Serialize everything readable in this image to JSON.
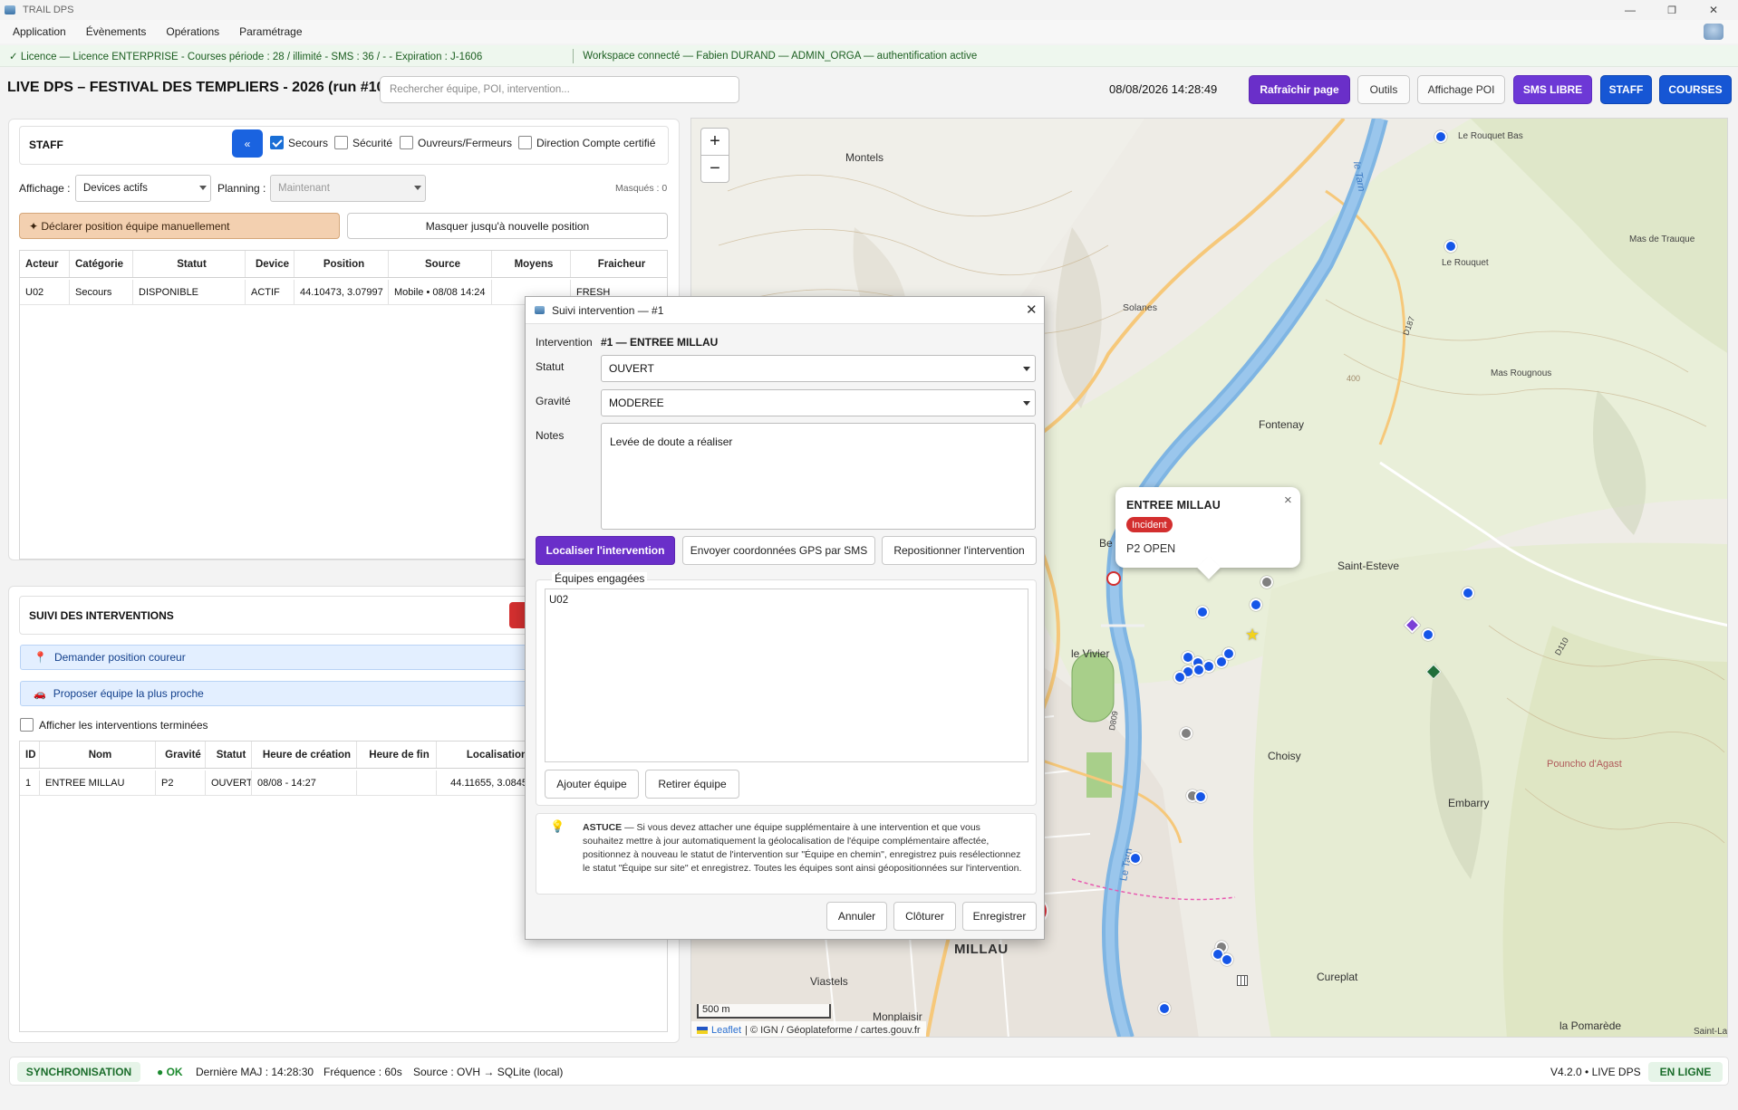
{
  "window": {
    "title": "TRAIL DPS",
    "minimize": "—",
    "maximize": "❐",
    "close": "✕"
  },
  "menu": [
    "Application",
    "Évènements",
    "Opérations",
    "Paramétrage"
  ],
  "license": {
    "left": "✓ Licence — Licence ENTERPRISE - Courses période : 28 / illimité - SMS : 36 / - - Expiration : J-1606",
    "right": "Workspace connecté — Fabien DURAND — ADMIN_ORGA — authentification active"
  },
  "header": {
    "title": "LIVE DPS – FESTIVAL DES TEMPLIERS - 2026 (run #10)",
    "search_placeholder": "Rechercher équipe, POI, intervention...",
    "datetime": "08/08/2026  14:28:49",
    "buttons": [
      "Rafraîchir page",
      "Outils",
      "Affichage POI",
      "SMS LIBRE",
      "STAFF",
      "COURSES"
    ]
  },
  "staff": {
    "title": "STAFF",
    "collapse_label": "«",
    "filters": [
      {
        "label": "Secours",
        "checked": true
      },
      {
        "label": "Sécurité",
        "checked": false
      },
      {
        "label": "Ouvreurs/Fermeurs",
        "checked": false
      },
      {
        "label": "Direction Compte certifié",
        "checked": false
      }
    ],
    "affichage_label": "Affichage :",
    "affichage_value": "Devices actifs",
    "planning_label": "Planning :",
    "planning_value": "Maintenant",
    "masques": "Masqués : 0",
    "declare_button": "✦  Déclarer position équipe manuellement",
    "hide_button": "Masquer jusqu'à nouvelle position",
    "columns": [
      "Acteur",
      "Catégorie",
      "Statut",
      "Device",
      "Position",
      "Source",
      "Moyens",
      "Fraicheur"
    ],
    "rows": [
      [
        "U02",
        "Secours",
        "DISPONIBLE",
        "ACTIF",
        "44.10473, 3.07997",
        "Mobile • 08/08 14:24",
        "",
        "FRESH"
      ]
    ]
  },
  "interventions": {
    "title": "SUIVI DES INTERVENTIONS",
    "request_runner": "Demander position coureur",
    "propose_team": "Proposer équipe la plus proche",
    "show_finished": "Afficher les interventions terminées",
    "columns": [
      "ID",
      "Nom",
      "Gravité",
      "Statut",
      "Heure de création",
      "Heure de fin",
      "Localisation"
    ],
    "rows": [
      [
        "1",
        "ENTREE MILLAU",
        "P2",
        "OUVERT",
        "08/08 - 14:27",
        "",
        "44.11655, 3.0845"
      ]
    ]
  },
  "map": {
    "zoom_in": "+",
    "zoom_out": "−",
    "scale": "500 m",
    "attribution_link": "Leaflet",
    "attribution_text": " | © IGN / Géoplateforme / cartes.gouv.fr",
    "labels": [
      "Montels",
      "le Tarn",
      "Le Rouquet Bas",
      "Mas de Trauque",
      "Le Rouquet",
      "Solanes",
      "Mas Rougnous",
      "Fontenay",
      "Saint-Esteve",
      "le Vivier",
      "Choisy",
      "Embarry",
      "Pouncho d'Agast",
      "MILLAU",
      "Viastels",
      "Cureplat",
      "Monplaisir",
      "la Pomarède",
      "Saint-Lar",
      "Le Tarn",
      "Be",
      "D809",
      "D187",
      "D110",
      "400"
    ]
  },
  "popup": {
    "title": "ENTREE MILLAU",
    "badge": "Incident",
    "status": "P2 OPEN",
    "close": "×"
  },
  "modal": {
    "title": "Suivi intervention — #1",
    "intervention_label": "Intervention",
    "intervention_value": "#1 — ENTREE MILLAU",
    "statut_label": "Statut",
    "statut_value": "OUVERT",
    "gravite_label": "Gravité",
    "gravite_value": "MODEREE",
    "notes_label": "Notes",
    "notes_value": "Levée de doute a réaliser",
    "btn_localiser": "Localiser l'intervention",
    "btn_sms": "Envoyer coordonnées GPS par SMS",
    "btn_reposition": "Repositionner l'intervention",
    "teams_label": "Équipes engagées",
    "teams": [
      "U02"
    ],
    "btn_add": "Ajouter équipe",
    "btn_remove": "Retirer équipe",
    "tip_head": "ASTUCE",
    "tip_body": "— Si vous devez attacher une équipe supplémentaire à une intervention et que vous souhaitez mettre à jour automatiquement la géolocalisation de l'équipe complémentaire affectée, positionnez à nouveau le statut de l'intervention sur \"Équipe en chemin\", enregistrez puis resélectionnez le statut \"Équipe sur site\" et enregistrez. Toutes les équipes sont ainsi géopositionnées sur l'intervention.",
    "btn_cancel": "Annuler",
    "btn_close": "Clôturer",
    "btn_save": "Enregistrer"
  },
  "footer": {
    "sync": "SYNCHRONISATION",
    "ok": "● OK",
    "last_update": "Dernière MAJ : 14:28:30",
    "frequency": "Fréquence : 60s",
    "source": "Source : OVH → SQLite (local)",
    "version": "V4.2.0 • LIVE DPS",
    "online": "EN LIGNE"
  },
  "colors": {
    "accent_purple": "#6a2fc9",
    "accent_blue": "#1656d4",
    "incident_red": "#d32f2f",
    "ok_green": "#1b6d2b"
  }
}
